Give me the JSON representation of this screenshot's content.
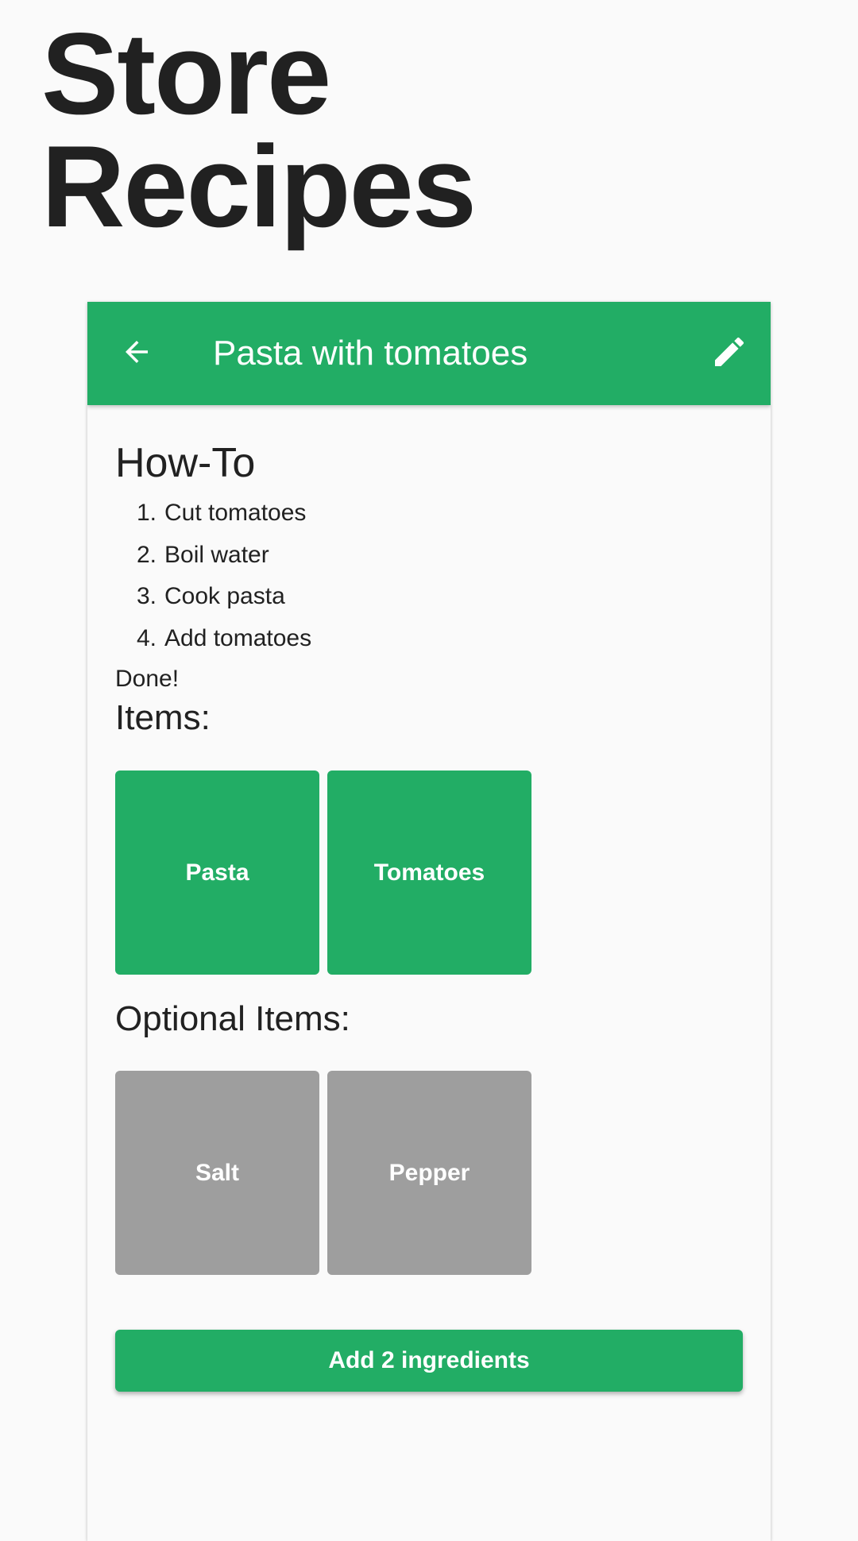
{
  "page": {
    "title_line1": "Store",
    "title_line2": "Recipes"
  },
  "appbar": {
    "back_icon": "arrow-left-icon",
    "title": "Pasta with tomatoes",
    "edit_icon": "pencil-icon",
    "color": "#22ad65"
  },
  "howto": {
    "heading": "How-To",
    "steps": [
      {
        "num": "1.",
        "text": "Cut tomatoes"
      },
      {
        "num": "2.",
        "text": "Boil water"
      },
      {
        "num": "3.",
        "text": "Cook pasta"
      },
      {
        "num": "4.",
        "text": "Add tomatoes"
      }
    ],
    "done": "Done!"
  },
  "items": {
    "heading": "Items:",
    "list": [
      "Pasta",
      "Tomatoes"
    ],
    "color": "#22ad65"
  },
  "optional_items": {
    "heading": "Optional Items:",
    "list": [
      "Salt",
      "Pepper"
    ],
    "color": "#9e9e9e"
  },
  "add_button": {
    "label": "Add 2 ingredients"
  }
}
